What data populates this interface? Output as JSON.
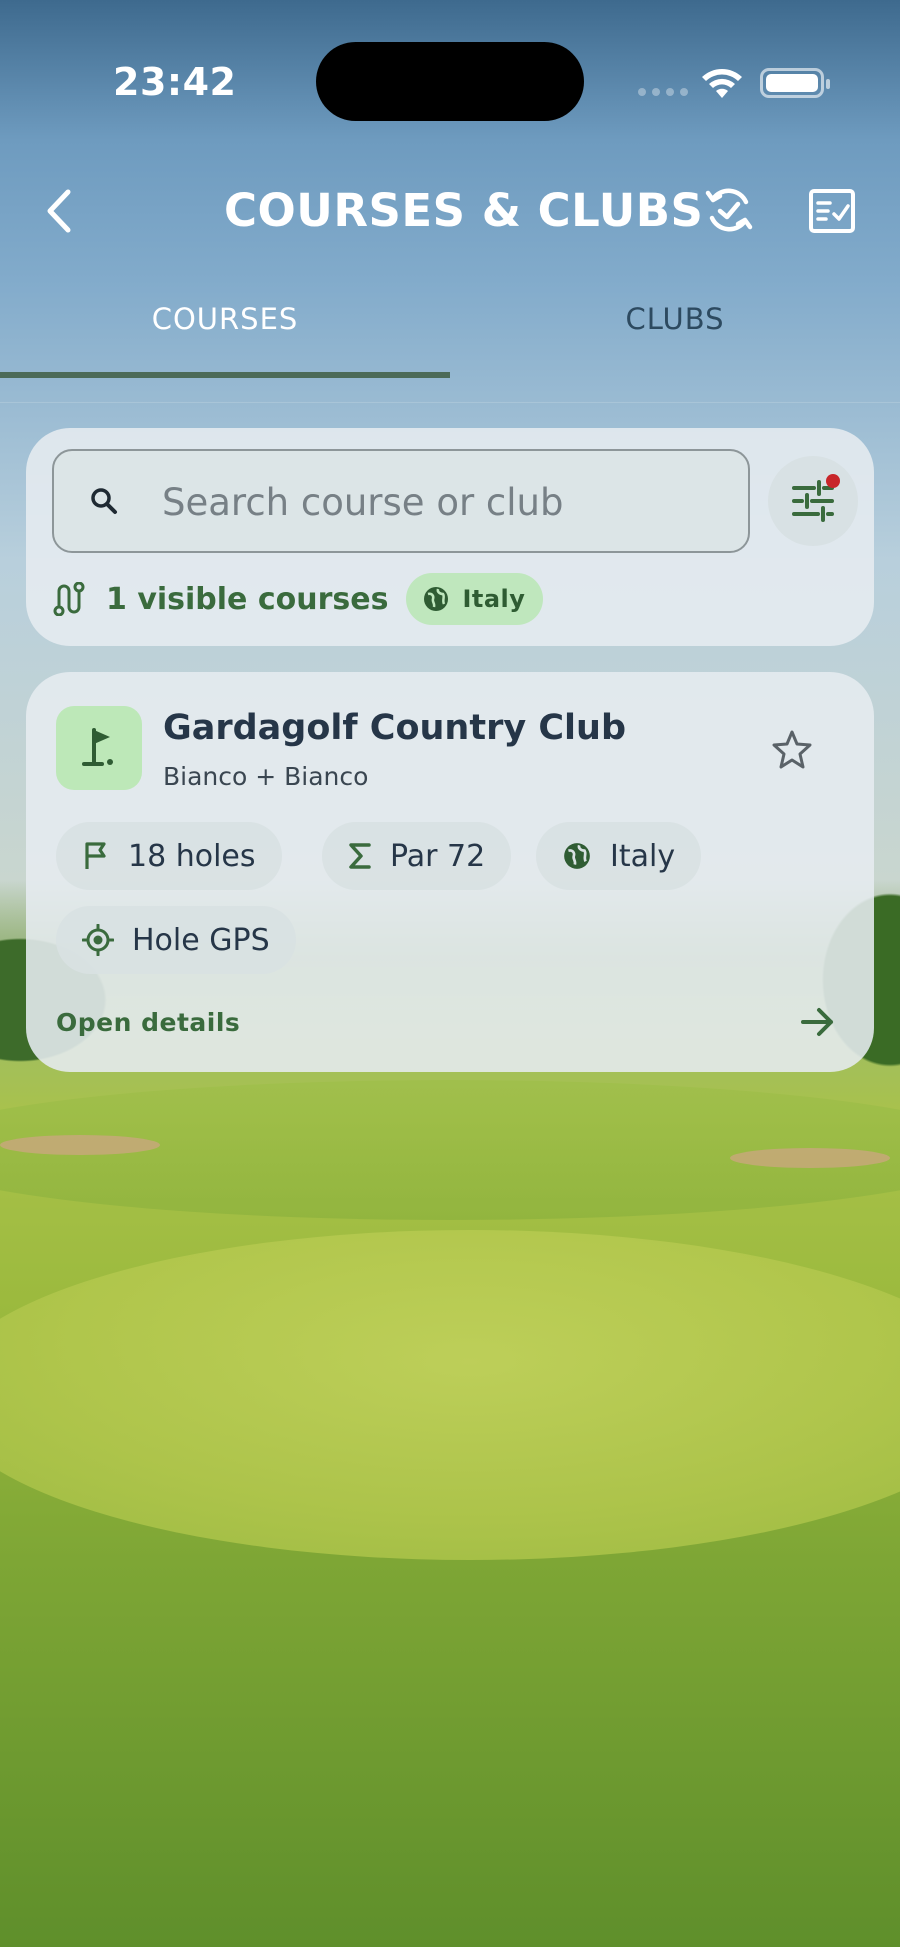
{
  "status_bar": {
    "time": "23:42"
  },
  "app_bar": {
    "title": "COURSES & CLUBS",
    "back_icon": "chevron-left-icon",
    "sync_icon": "sync-check-icon",
    "checklist_icon": "checklist-icon"
  },
  "tabs": [
    {
      "label": "COURSES",
      "active": true
    },
    {
      "label": "CLUBS",
      "active": false
    }
  ],
  "search": {
    "placeholder": "Search course or club",
    "value": "",
    "filter_has_active": true
  },
  "results": {
    "count_text": "1 visible courses",
    "country_filter": "Italy"
  },
  "courses": [
    {
      "name": "Gardagolf Country Club",
      "layout": "Bianco + Bianco",
      "holes": "18 holes",
      "par": "Par 72",
      "country": "Italy",
      "gps": "Hole GPS",
      "action": "Open details"
    }
  ],
  "colors": {
    "accent_green": "#3a6b3d",
    "chip_green": "#bfe7bd",
    "title_text": "#263648",
    "filter_dot": "#c8262a"
  }
}
